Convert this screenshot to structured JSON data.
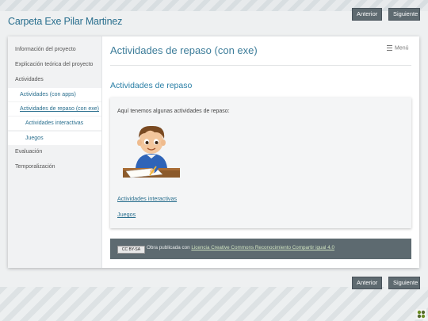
{
  "site": {
    "title": "Carpeta Exe Pilar Martinez"
  },
  "pagination": {
    "prev_label": "Anterior",
    "next_label": "Siguiente"
  },
  "sidebar": {
    "items": [
      {
        "label": "Información del proyecto"
      },
      {
        "label": "Explicación teórica del proyecto"
      },
      {
        "label": "Actividades"
      },
      {
        "label": "Actividades (con apps)"
      },
      {
        "label": "Actividades de repaso (con exe)"
      },
      {
        "label": "Actividades interactivas"
      },
      {
        "label": "Juegos"
      },
      {
        "label": "Evaluación"
      },
      {
        "label": "Temporalización"
      }
    ]
  },
  "main": {
    "page_title": "Actividades de repaso (con exe)",
    "menu_label": "Menú",
    "section_title": "Actividades de repaso",
    "intro_text": "Aquí tenemos algunas actividades de repaso:",
    "links": [
      "Actividades interactivas",
      "Juegos"
    ]
  },
  "footer": {
    "badge": "CC BY-SA",
    "text_prefix": "Obra publicada con ",
    "license_link": "Licencia Creative Commons Reconocimiento Compartir igual 4.0"
  },
  "colors": {
    "accent": "#2a6f8e",
    "footer_bg": "#5d6a70",
    "button_bg": "#5e6a70"
  }
}
